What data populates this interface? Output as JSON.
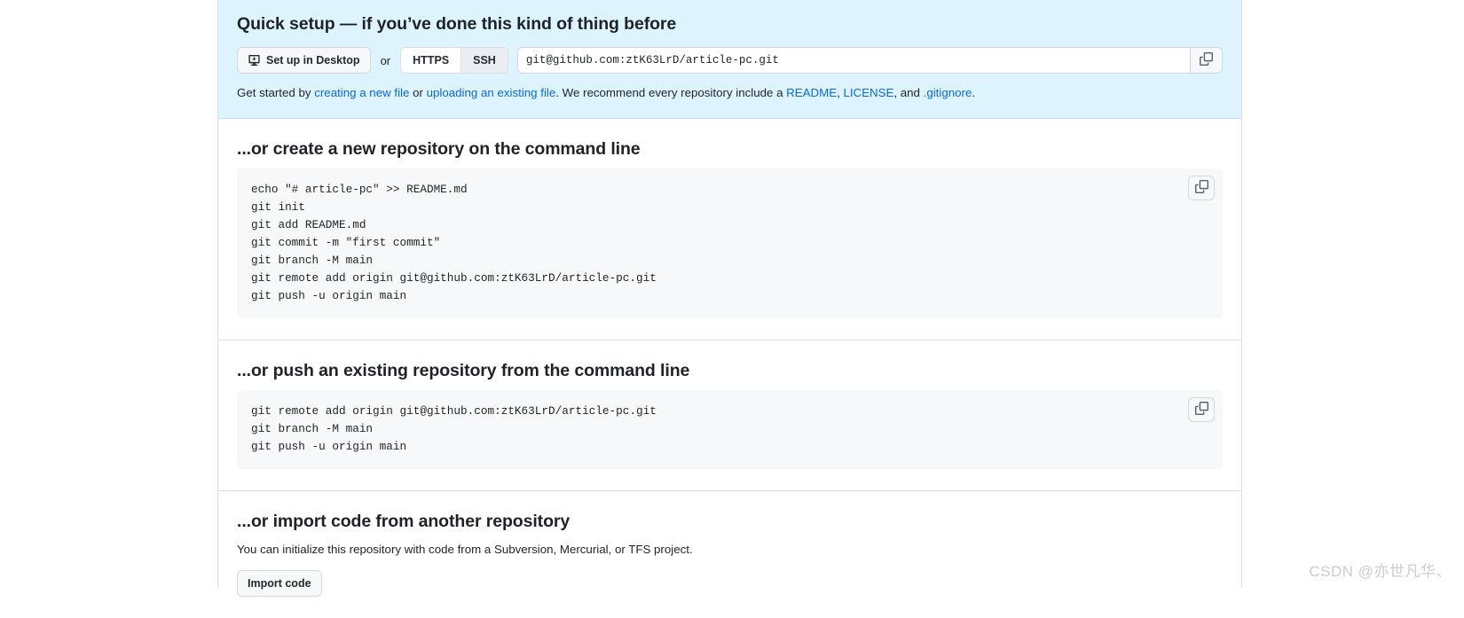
{
  "quick_setup": {
    "title": "Quick setup — if you’ve done this kind of thing before",
    "desktop_button": "Set up in Desktop",
    "or_label": "or",
    "protocols": [
      {
        "label": "HTTPS",
        "selected": false
      },
      {
        "label": "SSH",
        "selected": true
      }
    ],
    "clone_url": "git@github.com:ztK63LrD/article-pc.git",
    "copy_icon": "copy-icon",
    "get_started": {
      "prefix": "Get started by ",
      "link1": "creating a new file",
      "middle1": " or ",
      "link2": "uploading an existing file",
      "middle2": ". We recommend every repository include a ",
      "link3": "README",
      "sep1": ", ",
      "link4": "LICENSE",
      "sep2": ", and ",
      "link5": ".gitignore",
      "suffix": "."
    }
  },
  "create_repo_section": {
    "title": "...or create a new repository on the command line",
    "code": "echo \"# article-pc\" >> README.md\ngit init\ngit add README.md\ngit commit -m \"first commit\"\ngit branch -M main\ngit remote add origin git@github.com:ztK63LrD/article-pc.git\ngit push -u origin main",
    "copy_icon": "copy-icon"
  },
  "push_repo_section": {
    "title": "...or push an existing repository from the command line",
    "code": "git remote add origin git@github.com:ztK63LrD/article-pc.git\ngit branch -M main\ngit push -u origin main",
    "copy_icon": "copy-icon"
  },
  "import_section": {
    "title": "...or import code from another repository",
    "description": "You can initialize this repository with code from a Subversion, Mercurial, or TFS project.",
    "button": "Import code"
  },
  "watermark": "CSDN @亦世凡华、",
  "colors": {
    "banner_bg": "#ddf4ff",
    "banner_border": "#b6e3ff",
    "link": "#0969da",
    "code_bg": "#f6f8fa",
    "text": "#1f2328",
    "border": "#d8dee4"
  }
}
